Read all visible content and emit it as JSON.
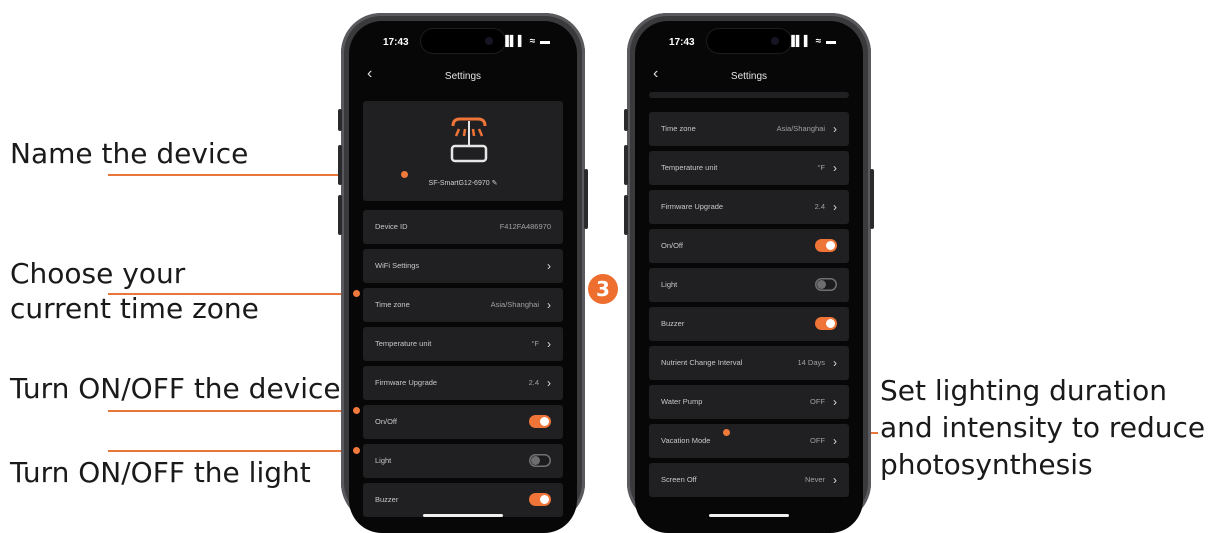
{
  "annotations": {
    "name_device": "Name the device",
    "time_zone_line1": "Choose your",
    "time_zone_line2": "current time zone",
    "toggle_device": "Turn ON/OFF the device",
    "toggle_light": "Turn ON/OFF the light",
    "lighting_line1": "Set lighting duration",
    "lighting_line2": "and intensity to reduce",
    "lighting_line3": "photosynthesis"
  },
  "step_badge": "3",
  "colors": {
    "accent": "#ef7437",
    "row_bg": "#202022",
    "screen_bg": "#070707"
  },
  "phone_left": {
    "status_time": "17:43",
    "status_icons": "▐▌▌ ≈ ▬",
    "nav_title": "Settings",
    "back_icon": "‹",
    "device_name": "SF-SmartG12-6970 ✎",
    "rows": {
      "device_id": {
        "label": "Device ID",
        "value": "F412FA486970"
      },
      "wifi": {
        "label": "WiFi Settings",
        "chev": "›"
      },
      "time_zone": {
        "label": "Time zone",
        "value": "Asia/Shanghai",
        "chev": "›"
      },
      "temperature": {
        "label": "Temperature unit",
        "value": "°F",
        "chev": "›"
      },
      "firmware": {
        "label": "Firmware Upgrade",
        "value": "2.4",
        "chev": "›"
      },
      "onoff": {
        "label": "On/Off",
        "toggle": "on"
      },
      "light": {
        "label": "Light",
        "toggle": "off"
      },
      "buzzer": {
        "label": "Buzzer",
        "toggle": "on"
      }
    }
  },
  "phone_right": {
    "status_time": "17:43",
    "status_icons": "▐▌▌ ≈ ▬",
    "nav_title": "Settings",
    "back_icon": "‹",
    "rows": {
      "time_zone": {
        "label": "Time zone",
        "value": "Asia/Shanghai",
        "chev": "›"
      },
      "temperature": {
        "label": "Temperature unit",
        "value": "°F",
        "chev": "›"
      },
      "firmware": {
        "label": "Firmware Upgrade",
        "value": "2.4",
        "chev": "›"
      },
      "onoff": {
        "label": "On/Off",
        "toggle": "on"
      },
      "light": {
        "label": "Light",
        "toggle": "off"
      },
      "buzzer": {
        "label": "Buzzer",
        "toggle": "on"
      },
      "nutrient": {
        "label": "Nutrient Change Interval",
        "value": "14 Days",
        "chev": "›"
      },
      "water_pump": {
        "label": "Water Pump",
        "value": "OFF",
        "chev": "›"
      },
      "vacation": {
        "label": "Vacation Mode",
        "value": "OFF",
        "chev": "›"
      },
      "screen_off": {
        "label": "Screen Off",
        "value": "Never",
        "chev": "›"
      }
    }
  }
}
